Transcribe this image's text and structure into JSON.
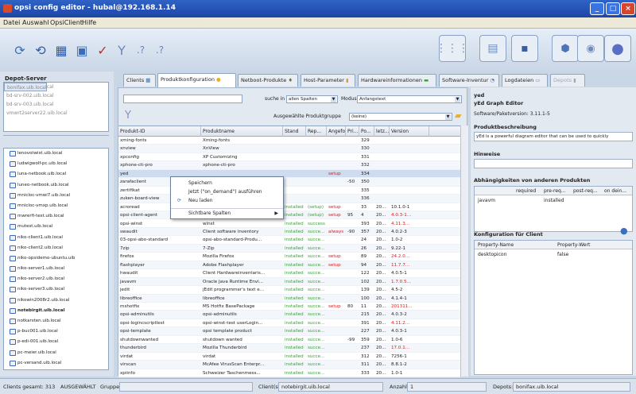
{
  "window": {
    "title": "opsi config editor - hubal@192.168.1.14"
  },
  "menu": [
    "Datei",
    "Auswahl",
    "OpsiClient",
    "Hilfe"
  ],
  "depot": {
    "label": "Depot-Server",
    "items": [
      "bonifax.uib.local",
      "bd-srv-001.uib.local",
      "bd-srv-002.uib.local",
      "bd-srv-003.uib.local",
      "vmwrt2server22.uib.local"
    ]
  },
  "clients": [
    {
      "name": "lenovotwist.uib.local",
      "bold": false
    },
    {
      "name": "ludwigwolf-pc.uib.local",
      "bold": false
    },
    {
      "name": "luna-netbook.uib.local",
      "bold": false
    },
    {
      "name": "luneo-netbook.uib.local",
      "bold": false
    },
    {
      "name": "mnicloc-vmwi7.uib.local",
      "bold": false
    },
    {
      "name": "mnicloc-vmxp.uib.local",
      "bold": false
    },
    {
      "name": "mwrerfi-test.uib.local",
      "bold": false
    },
    {
      "name": "mutest.uib.local",
      "bold": false
    },
    {
      "name": "niko-client1.uib.local",
      "bold": false
    },
    {
      "name": "niko-client2.uib.local",
      "bold": false
    },
    {
      "name": "niko-opsidemo-ubuntu.uib",
      "bold": false
    },
    {
      "name": "niko-server1.uib.local",
      "bold": false
    },
    {
      "name": "niko-server2.uib.local",
      "bold": false
    },
    {
      "name": "niko-server3.uib.local",
      "bold": false
    },
    {
      "name": "nikowin2008r2.uib.local",
      "bold": false
    },
    {
      "name": "notebirgit.uib.local",
      "bold": true
    },
    {
      "name": "notkarsten.uib.local",
      "bold": false
    },
    {
      "name": "p-buc001.uib.local",
      "bold": false
    },
    {
      "name": "p-edi-001.uib.local",
      "bold": false
    },
    {
      "name": "pc-meier.uib.local",
      "bold": false
    },
    {
      "name": "pc-versand.uib.local",
      "bold": false
    }
  ],
  "tabs": [
    "Clients",
    "Produktkonfiguration",
    "Netboot-Produkte",
    "Host-Parameter",
    "Hardwareinformationen",
    "Software-Inventur",
    "Logdateien",
    "Depots"
  ],
  "search": {
    "suche_in": "suche in",
    "scope": "allen Spalten",
    "modus_label": "Modus",
    "mode": "Anfangstext",
    "group_label": "Ausgewählte Produktgruppe",
    "group": "(keine)"
  },
  "columns": [
    "Produkt-ID",
    "Produktname",
    "Stand",
    "Rep...",
    "Angefo...",
    "Pri...",
    "Po...",
    "letz...",
    "Version"
  ],
  "rows": [
    [
      "xming-fonts",
      "Xming-fonts",
      "",
      "",
      "",
      "",
      "329",
      "",
      ""
    ],
    [
      "xnview",
      "XnView",
      "",
      "",
      "",
      "",
      "330",
      "",
      ""
    ],
    [
      "xpconfig",
      "XP Customizing",
      "",
      "",
      "",
      "",
      "331",
      "",
      ""
    ],
    [
      "xphone-cti-pro",
      "xphone-cti-pro",
      "",
      "",
      "",
      "",
      "332",
      "",
      ""
    ],
    [
      "yed",
      "",
      "",
      "",
      "setup",
      "",
      "334",
      "",
      ""
    ],
    [
      "zarafaclient",
      "",
      "",
      "",
      "",
      "-50",
      "350",
      "",
      ""
    ],
    [
      "zertifikat",
      "",
      "",
      "",
      "",
      "",
      "335",
      "",
      ""
    ],
    [
      "zuken-board-view",
      "",
      "",
      "",
      "",
      "",
      "336",
      "",
      ""
    ],
    [
      "acroread",
      "",
      "installed",
      "(setup)",
      "setup",
      "",
      "33",
      "20...",
      "10.1.0-1"
    ],
    [
      "opsi-client-agent",
      "",
      "installed",
      "(setup)",
      "setup",
      "95",
      "4",
      "20...",
      "4.0.3-1..."
    ],
    [
      "opsi-winst",
      "winst",
      "installed",
      "success",
      "",
      "",
      "393",
      "20...",
      "4.11.3..."
    ],
    [
      "swaudit",
      "Client software inventory",
      "installed",
      "succe...",
      "always",
      "-90",
      "357",
      "20...",
      "4.0.2-3"
    ],
    [
      "03-opsi-abo-standard",
      "opsi-abo-standard-Produ...",
      "installed",
      "succe...",
      "",
      "",
      "24",
      "20...",
      "1.0-2"
    ],
    [
      "7zip",
      "7-Zip",
      "installed",
      "succe...",
      "",
      "",
      "26",
      "20...",
      "9.22-1"
    ],
    [
      "firefox",
      "Mozilla Firefox",
      "installed",
      "succe...",
      "setup",
      "",
      "89",
      "20...",
      "24.2.0..."
    ],
    [
      "flashplayer",
      "Adobe Flashplayer",
      "installed",
      "succe...",
      "setup",
      "",
      "94",
      "20...",
      "11.7.7..."
    ],
    [
      "hwaudit",
      "Client Hardwareinventaris...",
      "installed",
      "succe...",
      "",
      "",
      "122",
      "20...",
      "4.0.5-1"
    ],
    [
      "javavm",
      "Oracle Java Runtime Envi...",
      "installed",
      "succe...",
      "",
      "",
      "102",
      "20...",
      "1.7.0.5..."
    ],
    [
      "jedit",
      "jEdit programmer's text e...",
      "installed",
      "succe...",
      "",
      "",
      "139",
      "20...",
      "4.5-2"
    ],
    [
      "libreoffice",
      "libreoffice",
      "installed",
      "succe...",
      "",
      "",
      "100",
      "20...",
      "4.1.4-1"
    ],
    [
      "mshotfix",
      "MS Hotfix BasePackage",
      "installed",
      "succe...",
      "setup",
      "80",
      "11",
      "20...",
      "201311..."
    ],
    [
      "opsi-adminutils",
      "opsi-adminutils",
      "installed",
      "succe...",
      "",
      "",
      "215",
      "20...",
      "4.0.3-2"
    ],
    [
      "opsi-logincscriptlest",
      "opsi-winst-test userLogin...",
      "installed",
      "succe...",
      "",
      "",
      "391",
      "20...",
      "4.11.2..."
    ],
    [
      "opsi-template",
      "opsi template product",
      "installed",
      "succe...",
      "",
      "",
      "227",
      "20...",
      "4.0.3-1"
    ],
    [
      "shutdownwanted",
      "shutdown wanted",
      "installed",
      "succe...",
      "",
      "-99",
      "359",
      "20...",
      "1.0-6"
    ],
    [
      "thunderbird",
      "Mozilla Thunderbird",
      "installed",
      "succe...",
      "",
      "",
      "237",
      "20...",
      "17.0.1..."
    ],
    [
      "virdat",
      "virdat",
      "installed",
      "succe...",
      "",
      "",
      "312",
      "20...",
      "7256-1"
    ],
    [
      "virscan",
      "McAfee VirusScan Enterpr...",
      "installed",
      "succe...",
      "",
      "",
      "311",
      "20...",
      "8.8.1-2"
    ],
    [
      "xpiinfo",
      "Schweizer Taschenmess...",
      "installed",
      "succe...",
      "",
      "",
      "333",
      "20...",
      "1.0-1"
    ]
  ],
  "context_menu": [
    "Speichern",
    "Jetzt (\"on_demand\") ausführen",
    "Neu laden",
    "Sichtbare Spalten"
  ],
  "right": {
    "product_id": "yed",
    "product_name": "yEd Graph Editor",
    "version": "Software/Paketversion: 3.11.1-5",
    "desc_label": "Produktbeschreibung",
    "desc": "yEd is a powerful diagram editor that can be used to quickly",
    "hints_label": "Hinweise",
    "deps_label": "Abhängigkeiten von anderen Produkten",
    "deps_cols": [
      "required",
      "pre-req...",
      "post-req...",
      "on dein..."
    ],
    "deps_row": [
      "javavm",
      "",
      "installed",
      "",
      ""
    ],
    "config_label": "Konfiguration für Client",
    "prop_cols": [
      "Property-Name",
      "Property-Wert"
    ],
    "prop_row": [
      "desktopicon",
      "false"
    ]
  },
  "status": {
    "clients_total": "Clients gesamt: 313",
    "selected": "AUSGEWÄHLT",
    "group": "Gruppe:",
    "clients_label": "Client(s):",
    "clients_value": "notebirgit.uib.local",
    "count_label": "Anzahl:",
    "count_value": "1",
    "depots_label": "Depots:",
    "depots_value": "bonifax.uib.local"
  },
  "colors": {
    "green": "#3c9a3c",
    "red": "#d02020",
    "titlebar": "#2f63c6"
  }
}
